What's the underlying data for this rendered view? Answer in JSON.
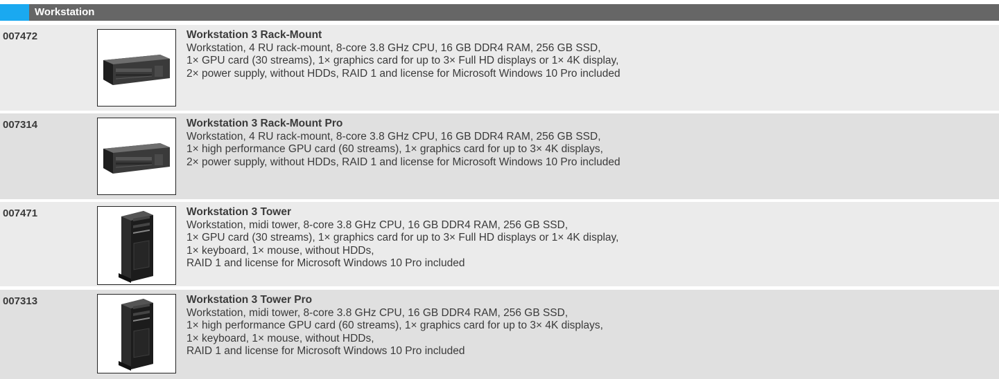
{
  "section": {
    "title": "Workstation",
    "accent_color": "#1aa9f0",
    "header_color": "#666666"
  },
  "products": [
    {
      "article": "007472",
      "name": "Workstation 3 Rack-Mount",
      "image_icon": "rack-mount-server-icon",
      "lines": [
        "Workstation, 4 RU rack-mount, 8-core 3.8 GHz CPU, 16 GB DDR4 RAM, 256 GB SSD,",
        "1× GPU card (30 streams), 1× graphics card for up to 3× Full HD displays or 1× 4K display,",
        "2× power supply, without HDDs, RAID 1 and license for Microsoft Windows 10 Pro included"
      ]
    },
    {
      "article": "007314",
      "name": "Workstation 3 Rack-Mount Pro",
      "image_icon": "rack-mount-server-icon",
      "lines": [
        "Workstation, 4 RU rack-mount, 8-core 3.8 GHz CPU, 16 GB DDR4 RAM, 256 GB SSD,",
        "1× high performance GPU card (60 streams), 1× graphics card for up to 3× 4K displays,",
        "2× power supply, without HDDs, RAID 1 and license for Microsoft Windows 10 Pro included"
      ]
    },
    {
      "article": "007471",
      "name": "Workstation 3 Tower",
      "image_icon": "tower-pc-icon",
      "lines": [
        "Workstation, midi tower, 8-core 3.8 GHz CPU, 16 GB DDR4 RAM, 256 GB SSD,",
        "1× GPU card (30 streams), 1× graphics card for up to 3× Full HD displays or 1× 4K display,",
        "1× keyboard, 1× mouse, without HDDs,",
        "RAID 1 and license for Microsoft Windows 10 Pro included"
      ]
    },
    {
      "article": "007313",
      "name": "Workstation 3 Tower Pro",
      "image_icon": "tower-pc-icon",
      "lines": [
        "Workstation, midi tower, 8-core 3.8 GHz CPU, 16 GB DDR4 RAM, 256 GB SSD,",
        "1× high performance GPU card (60 streams), 1× graphics card for up to 3× 4K displays,",
        "1× keyboard, 1× mouse, without HDDs,",
        "RAID 1 and license for Microsoft Windows 10 Pro included"
      ]
    }
  ]
}
